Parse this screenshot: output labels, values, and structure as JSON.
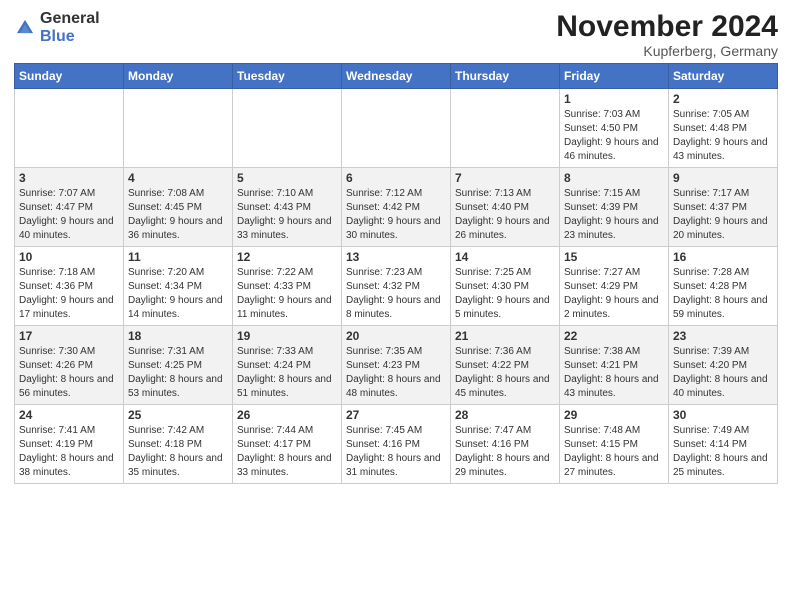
{
  "header": {
    "logo_general": "General",
    "logo_blue": "Blue",
    "month_title": "November 2024",
    "location": "Kupferberg, Germany"
  },
  "columns": [
    "Sunday",
    "Monday",
    "Tuesday",
    "Wednesday",
    "Thursday",
    "Friday",
    "Saturday"
  ],
  "weeks": [
    [
      {
        "day": "",
        "info": ""
      },
      {
        "day": "",
        "info": ""
      },
      {
        "day": "",
        "info": ""
      },
      {
        "day": "",
        "info": ""
      },
      {
        "day": "",
        "info": ""
      },
      {
        "day": "1",
        "info": "Sunrise: 7:03 AM\nSunset: 4:50 PM\nDaylight: 9 hours\nand 46 minutes."
      },
      {
        "day": "2",
        "info": "Sunrise: 7:05 AM\nSunset: 4:48 PM\nDaylight: 9 hours\nand 43 minutes."
      }
    ],
    [
      {
        "day": "3",
        "info": "Sunrise: 7:07 AM\nSunset: 4:47 PM\nDaylight: 9 hours\nand 40 minutes."
      },
      {
        "day": "4",
        "info": "Sunrise: 7:08 AM\nSunset: 4:45 PM\nDaylight: 9 hours\nand 36 minutes."
      },
      {
        "day": "5",
        "info": "Sunrise: 7:10 AM\nSunset: 4:43 PM\nDaylight: 9 hours\nand 33 minutes."
      },
      {
        "day": "6",
        "info": "Sunrise: 7:12 AM\nSunset: 4:42 PM\nDaylight: 9 hours\nand 30 minutes."
      },
      {
        "day": "7",
        "info": "Sunrise: 7:13 AM\nSunset: 4:40 PM\nDaylight: 9 hours\nand 26 minutes."
      },
      {
        "day": "8",
        "info": "Sunrise: 7:15 AM\nSunset: 4:39 PM\nDaylight: 9 hours\nand 23 minutes."
      },
      {
        "day": "9",
        "info": "Sunrise: 7:17 AM\nSunset: 4:37 PM\nDaylight: 9 hours\nand 20 minutes."
      }
    ],
    [
      {
        "day": "10",
        "info": "Sunrise: 7:18 AM\nSunset: 4:36 PM\nDaylight: 9 hours\nand 17 minutes."
      },
      {
        "day": "11",
        "info": "Sunrise: 7:20 AM\nSunset: 4:34 PM\nDaylight: 9 hours\nand 14 minutes."
      },
      {
        "day": "12",
        "info": "Sunrise: 7:22 AM\nSunset: 4:33 PM\nDaylight: 9 hours\nand 11 minutes."
      },
      {
        "day": "13",
        "info": "Sunrise: 7:23 AM\nSunset: 4:32 PM\nDaylight: 9 hours\nand 8 minutes."
      },
      {
        "day": "14",
        "info": "Sunrise: 7:25 AM\nSunset: 4:30 PM\nDaylight: 9 hours\nand 5 minutes."
      },
      {
        "day": "15",
        "info": "Sunrise: 7:27 AM\nSunset: 4:29 PM\nDaylight: 9 hours\nand 2 minutes."
      },
      {
        "day": "16",
        "info": "Sunrise: 7:28 AM\nSunset: 4:28 PM\nDaylight: 8 hours\nand 59 minutes."
      }
    ],
    [
      {
        "day": "17",
        "info": "Sunrise: 7:30 AM\nSunset: 4:26 PM\nDaylight: 8 hours\nand 56 minutes."
      },
      {
        "day": "18",
        "info": "Sunrise: 7:31 AM\nSunset: 4:25 PM\nDaylight: 8 hours\nand 53 minutes."
      },
      {
        "day": "19",
        "info": "Sunrise: 7:33 AM\nSunset: 4:24 PM\nDaylight: 8 hours\nand 51 minutes."
      },
      {
        "day": "20",
        "info": "Sunrise: 7:35 AM\nSunset: 4:23 PM\nDaylight: 8 hours\nand 48 minutes."
      },
      {
        "day": "21",
        "info": "Sunrise: 7:36 AM\nSunset: 4:22 PM\nDaylight: 8 hours\nand 45 minutes."
      },
      {
        "day": "22",
        "info": "Sunrise: 7:38 AM\nSunset: 4:21 PM\nDaylight: 8 hours\nand 43 minutes."
      },
      {
        "day": "23",
        "info": "Sunrise: 7:39 AM\nSunset: 4:20 PM\nDaylight: 8 hours\nand 40 minutes."
      }
    ],
    [
      {
        "day": "24",
        "info": "Sunrise: 7:41 AM\nSunset: 4:19 PM\nDaylight: 8 hours\nand 38 minutes."
      },
      {
        "day": "25",
        "info": "Sunrise: 7:42 AM\nSunset: 4:18 PM\nDaylight: 8 hours\nand 35 minutes."
      },
      {
        "day": "26",
        "info": "Sunrise: 7:44 AM\nSunset: 4:17 PM\nDaylight: 8 hours\nand 33 minutes."
      },
      {
        "day": "27",
        "info": "Sunrise: 7:45 AM\nSunset: 4:16 PM\nDaylight: 8 hours\nand 31 minutes."
      },
      {
        "day": "28",
        "info": "Sunrise: 7:47 AM\nSunset: 4:16 PM\nDaylight: 8 hours\nand 29 minutes."
      },
      {
        "day": "29",
        "info": "Sunrise: 7:48 AM\nSunset: 4:15 PM\nDaylight: 8 hours\nand 27 minutes."
      },
      {
        "day": "30",
        "info": "Sunrise: 7:49 AM\nSunset: 4:14 PM\nDaylight: 8 hours\nand 25 minutes."
      }
    ]
  ]
}
